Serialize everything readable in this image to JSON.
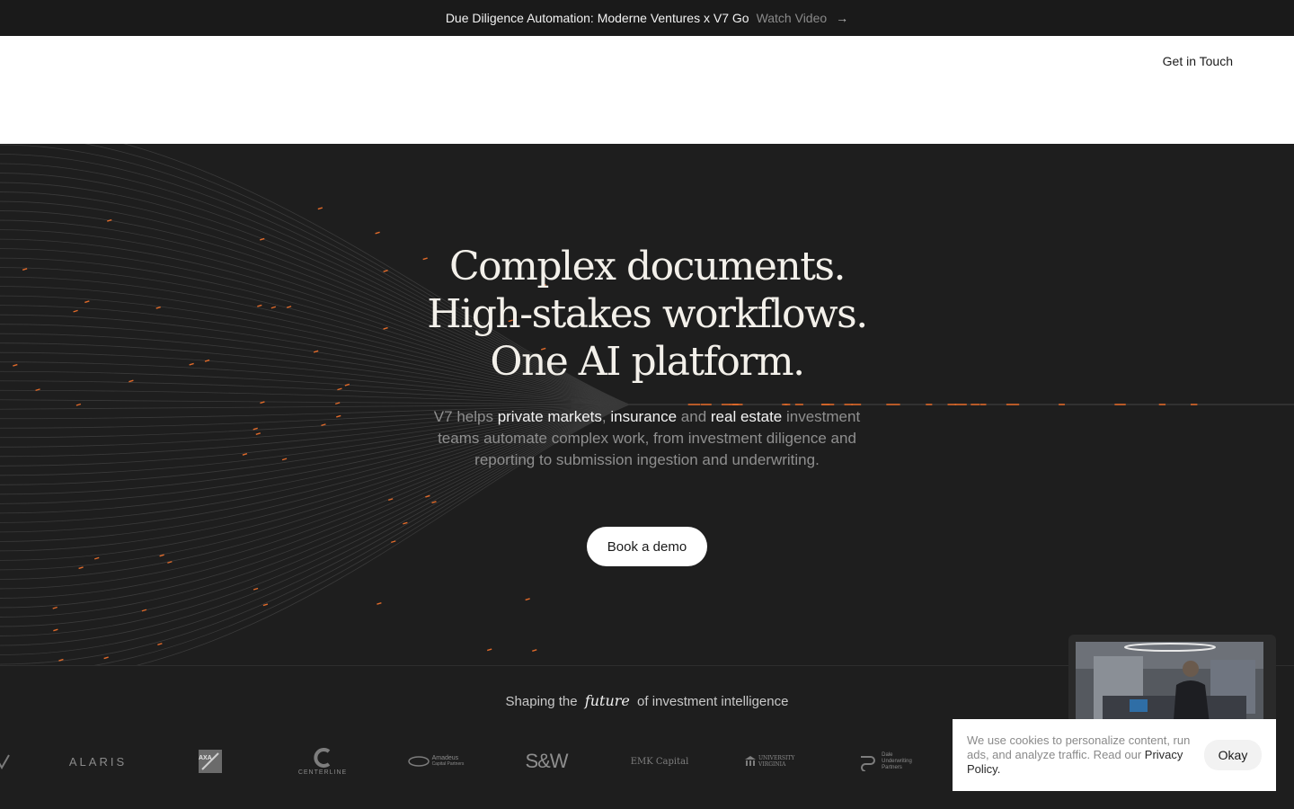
{
  "announcement": {
    "message": "Due Diligence Automation: Moderne Ventures x V7 Go",
    "link_label": "Watch Video",
    "arrow": "→"
  },
  "nav": {
    "cta_label": "Get in Touch"
  },
  "hero": {
    "headline_lines": [
      "Complex documents.",
      "High-stakes workflows.",
      "One AI platform."
    ],
    "sub": {
      "p1": "V7 helps ",
      "h1": "private markets",
      "p2": ", ",
      "h2": "insurance",
      "p3": " and ",
      "h3": "real estate",
      "p4": " investment teams automate complex work, from investment diligence and reporting to submission ingestion and underwriting."
    },
    "cta_label": "Book a demo"
  },
  "trust": {
    "prefix": "Shaping the",
    "emphasis": "future",
    "suffix": "of investment intelligence"
  },
  "logos": [
    {
      "name": "ALARIS"
    },
    {
      "name": "AXA"
    },
    {
      "name": "CENTERLINE"
    },
    {
      "name": "Amadeus"
    },
    {
      "name": "Capital Partners"
    },
    {
      "name": "S&W"
    },
    {
      "name": "EMK Capital"
    },
    {
      "name": "UNIVERSITY VIRGINIA"
    },
    {
      "name": "Dale"
    },
    {
      "name": "Underwriting"
    },
    {
      "name": "Partners"
    }
  ],
  "cookie": {
    "text": "We use cookies to personalize content, run ads, and analyze traffic. Read our ",
    "policy_label": "Privacy Policy.",
    "ok_label": "Okay"
  },
  "colors": {
    "background": "#1e1e1e",
    "accent_orange": "#e06a2a",
    "white": "#ffffff"
  }
}
